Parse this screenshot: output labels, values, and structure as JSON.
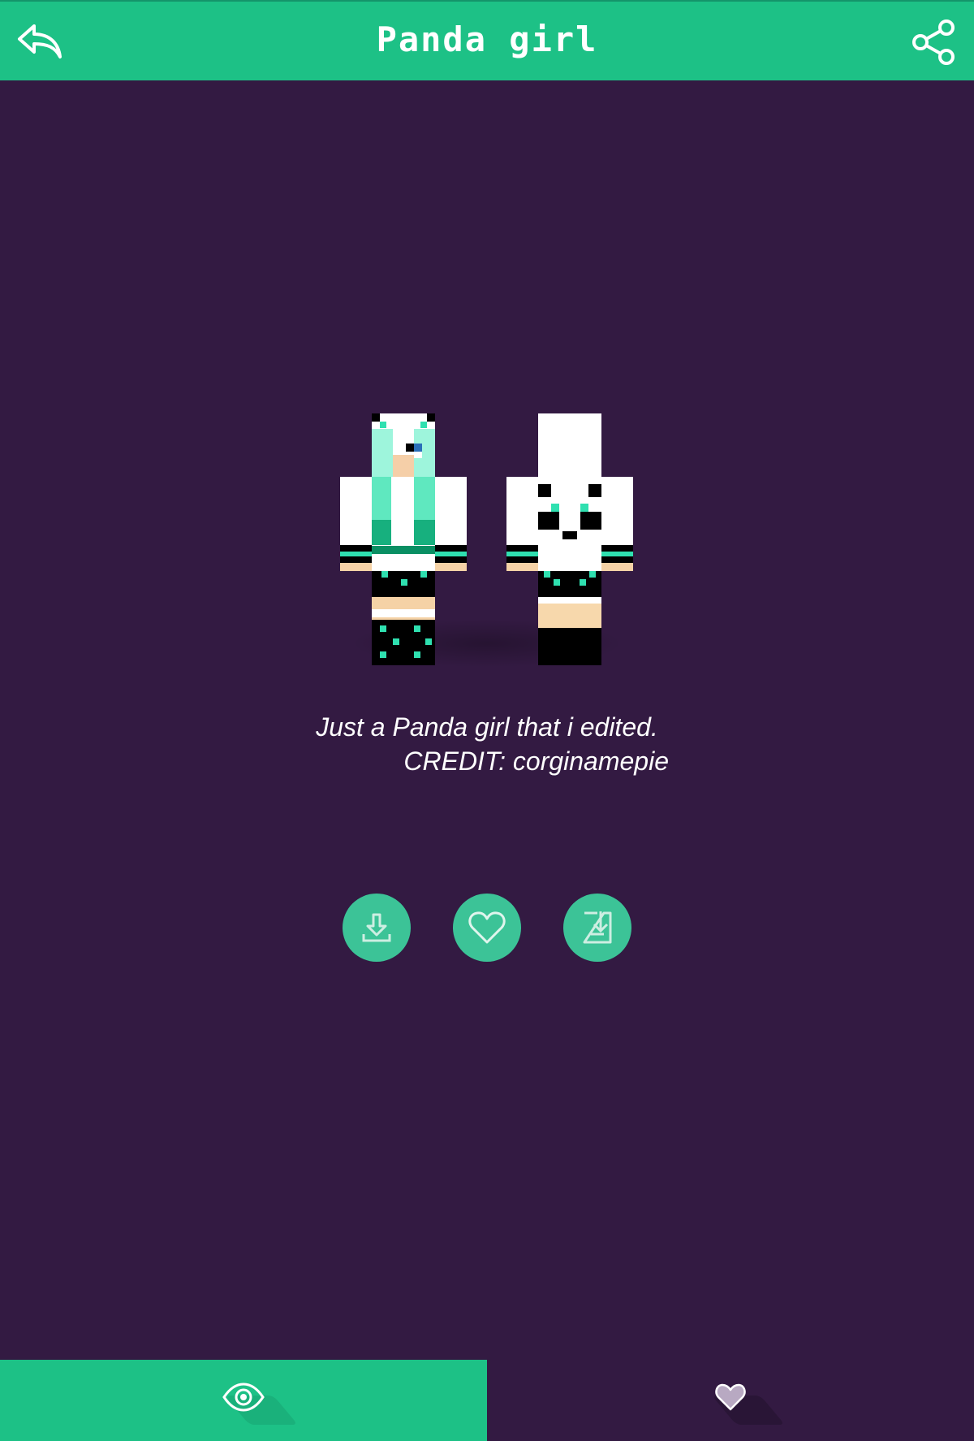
{
  "header": {
    "title": "Panda girl",
    "back_icon": "reply-arrow-icon",
    "share_icon": "share-icon"
  },
  "skin": {
    "front_view": "skin-front",
    "back_view": "skin-back"
  },
  "description": {
    "line1": "Just a Panda girl that i edited.",
    "line2": "CREDIT: corginamepie"
  },
  "actions": [
    {
      "icon": "download-icon"
    },
    {
      "icon": "heart-icon"
    },
    {
      "icon": "save-to-device-icon"
    }
  ],
  "tabs": [
    {
      "icon": "eye-icon",
      "active": true
    },
    {
      "icon": "heart-icon",
      "active": false
    }
  ],
  "colors": {
    "accent": "#1dc186",
    "background": "#331a42",
    "action_button": "#3cc397"
  }
}
